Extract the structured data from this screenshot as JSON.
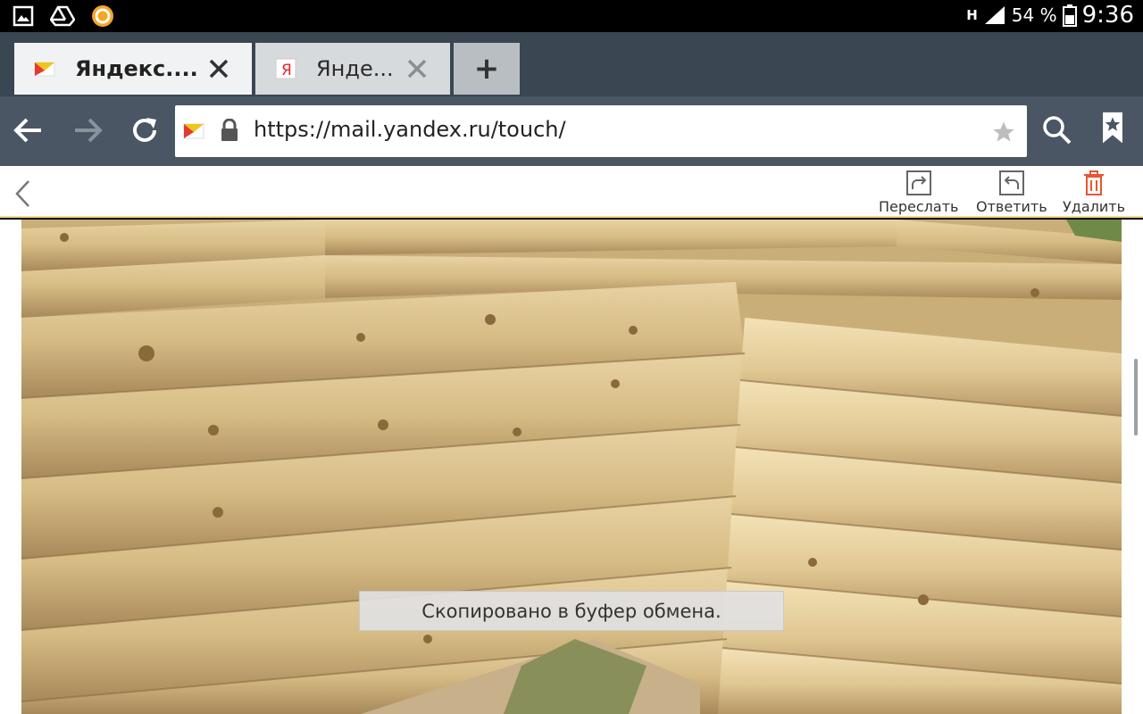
{
  "status_bar": {
    "notification_icons": [
      "gallery-icon",
      "drive-icon",
      "app-icon"
    ],
    "network": "H",
    "battery": "54 %",
    "time": "9:36"
  },
  "tabs": [
    {
      "title": "Яндекс....",
      "favicon": "yandex-mail-icon",
      "active": true
    },
    {
      "title": "Янде...",
      "favicon": "yandex-icon",
      "active": false
    }
  ],
  "new_tab_label": "+",
  "toolbar": {
    "url": "https://mail.yandex.ru/touch/"
  },
  "mail_actions": {
    "forward": "Переслать",
    "reply": "Ответить",
    "delete": "Удалить"
  },
  "toast": "Скопировано в буфер обмена.",
  "colors": {
    "tab_strip": "#3a4652",
    "toolbar": "#4a5663",
    "delete_accent": "#e8562f",
    "action_border": "#f3dc8a"
  }
}
